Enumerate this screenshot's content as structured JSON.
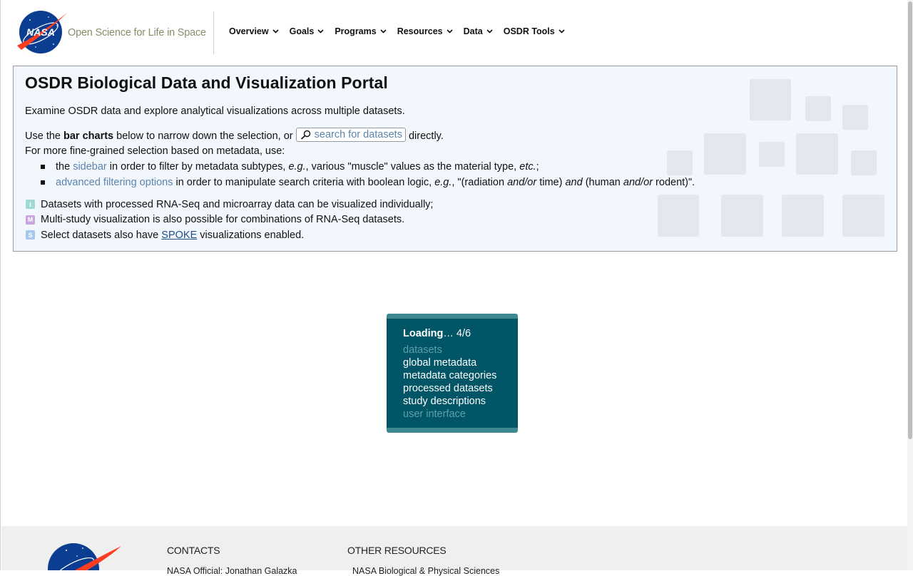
{
  "header": {
    "site_name": "Open Science for Life in Space",
    "nav": [
      {
        "label": "Overview",
        "icon": "chevron-down-icon"
      },
      {
        "label": "Goals",
        "icon": "chevron-down-icon"
      },
      {
        "label": "Programs",
        "icon": "chevron-down-icon"
      },
      {
        "label": "Resources",
        "icon": "chevron-down-icon"
      },
      {
        "label": "Data",
        "icon": "chevron-down-icon"
      },
      {
        "label": "OSDR Tools",
        "icon": "chevron-down-icon"
      }
    ]
  },
  "intro": {
    "title": "OSDR Biological Data and Visualization Portal",
    "subtitle": "Examine OSDR data and explore analytical visualizations across multiple datasets.",
    "line2": {
      "prefix": "Use the ",
      "bold": "bar charts",
      "middle": " below to narrow down the selection, or ",
      "search_label": "search for datasets",
      "suffix": " directly."
    },
    "line3": "For more fine-grained selection based on metadata, use:",
    "bullets": [
      {
        "prefix": "the ",
        "link": "sidebar",
        "t1": " in order to filter by metadata subtypes, ",
        "i1": "e.g.",
        "t2": ", various \"muscle\" values as the material type, ",
        "i2": "etc.",
        "t3": ";"
      },
      {
        "link": "advanced filtering options",
        "t1": " in order to manipulate search criteria with boolean logic, ",
        "i1": "e.g.",
        "t2": ", \"(radiation ",
        "i2": "and/or",
        "t3": " time) ",
        "i3": "and",
        "t4": " (human ",
        "i4": "and/or",
        "t5": " rodent)\"."
      }
    ],
    "legend": [
      {
        "badge": "I",
        "color": "#9fd8d4",
        "text": "Datasets with processed RNA-Seq and microarray data can be visualized individually;"
      },
      {
        "badge": "M",
        "color": "#c7a6e0",
        "text": "Multi-study visualization is also possible for combinations of RNA-Seq datasets."
      },
      {
        "badge": "S",
        "color": "#a7c8ee",
        "text_before": "Select datasets also have ",
        "link": "SPOKE",
        "text_after": " visualizations enabled."
      }
    ]
  },
  "loading": {
    "label": "Loading",
    "progress": "… 4/6",
    "steps": [
      {
        "text": "datasets",
        "done": true
      },
      {
        "text": "global metadata",
        "done": false
      },
      {
        "text": "metadata categories",
        "done": false
      },
      {
        "text": "processed datasets",
        "done": false
      },
      {
        "text": "study descriptions",
        "done": false
      },
      {
        "text": "user interface",
        "done": true
      }
    ]
  },
  "footer": {
    "contacts_heading": "CONTACTS",
    "contacts_line": "NASA Official: Jonathan Galazka",
    "resources_heading": "OTHER RESOURCES",
    "resources_line": "NASA Biological & Physical Sciences"
  },
  "colors": {
    "panel_bg": "#f2f6fd",
    "loading_bg": "#005566",
    "link": "#5b85ac"
  }
}
